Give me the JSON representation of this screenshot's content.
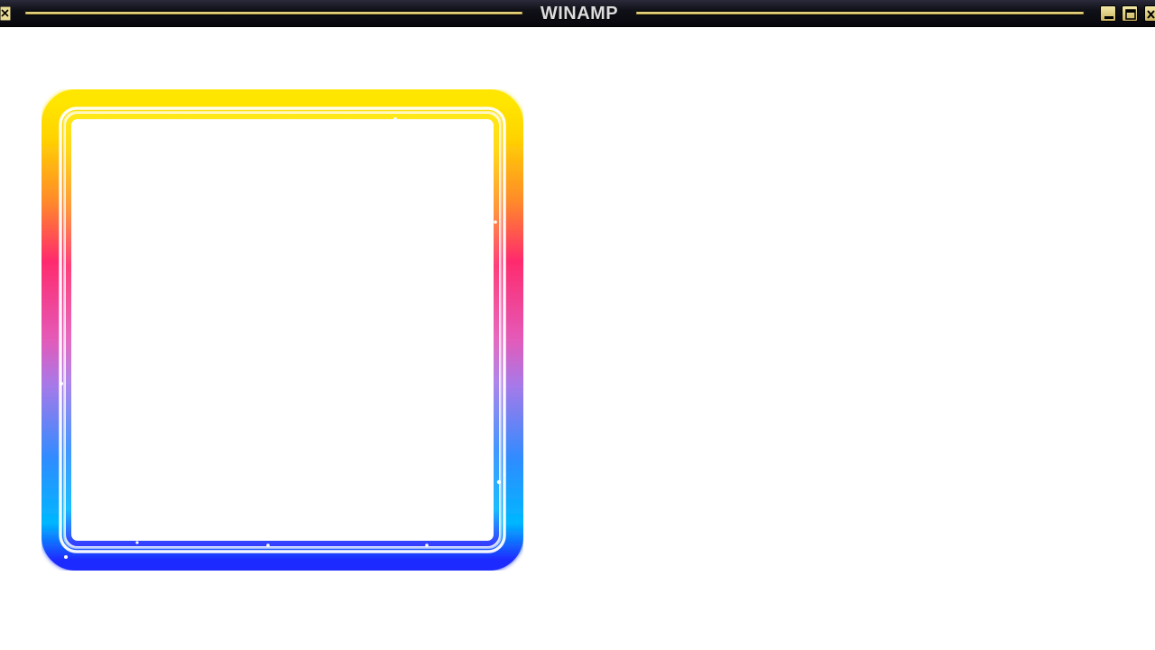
{
  "window": {
    "title": "WINAMP"
  },
  "titlebar_buttons": {
    "minimize_icon": "minimize-icon",
    "shade_icon": "windowshade-icon",
    "close_icon": "close-icon"
  },
  "frame": {
    "colors": [
      "#ffe600",
      "#ff2a6d",
      "#a779e9",
      "#00b7ff",
      "#1f2bff"
    ]
  }
}
